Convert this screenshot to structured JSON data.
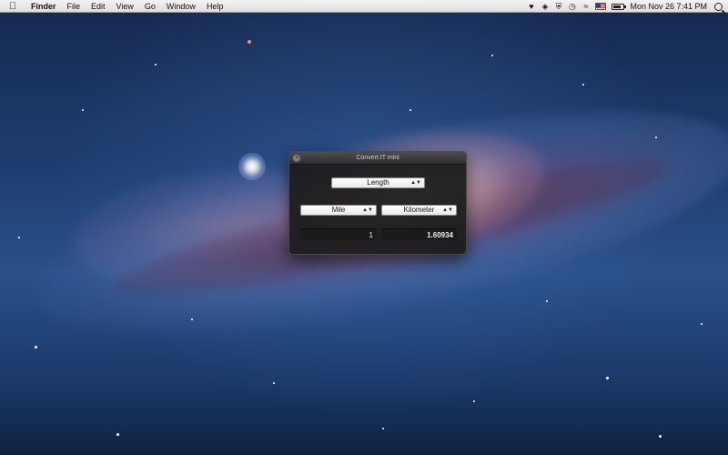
{
  "menubar": {
    "app_name": "Finder",
    "items": [
      "File",
      "Edit",
      "View",
      "Go",
      "Window",
      "Help"
    ],
    "status_icons": [
      "heart-icon",
      "dropbox-icon",
      "shield-icon",
      "timemachine-icon",
      "wifi-icon",
      "flag-icon",
      "battery-icon"
    ],
    "datetime": "Mon Nov 26  7:41 PM"
  },
  "window": {
    "title": "Convert.IT mini",
    "category": "Length",
    "from_unit": "Mile",
    "to_unit": "Kilometer",
    "from_value": "1",
    "to_value": "1.60934"
  }
}
